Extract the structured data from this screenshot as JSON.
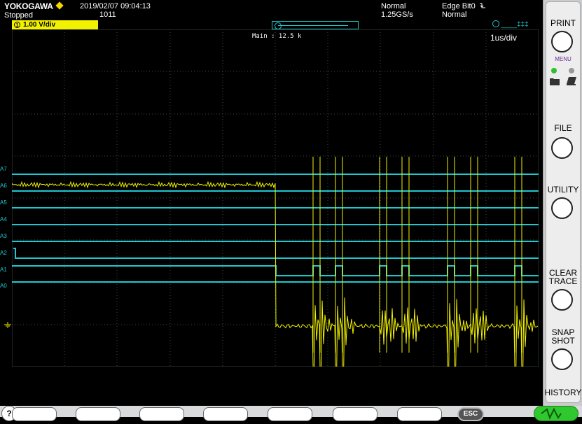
{
  "header": {
    "brand": "YOKOGAWA",
    "status": "Stopped",
    "datetime": "2019/02/07  09:04:13",
    "acq_count": "1011",
    "acq_mode": "Normal",
    "sample_rate": "1.25GS/s",
    "trigger": "Edge Bit0",
    "trigger_mode": "Normal"
  },
  "channel": {
    "num": "1",
    "scale": "1.00 V/div"
  },
  "display": {
    "zoom_label": "Main : 12.5 k",
    "timebase": "1us/div"
  },
  "logic_labels": [
    "A7",
    "A6",
    "A5",
    "A4",
    "A3",
    "A2",
    "A1",
    "A0"
  ],
  "side_panel": {
    "print": "PRINT",
    "menu": "MENU",
    "file": "FILE",
    "utility": "UTILITY",
    "clear_trace_1": "CLEAR",
    "clear_trace_2": "TRACE",
    "snap_1": "SNAP",
    "snap_2": "SHOT",
    "history": "HISTORY"
  },
  "bottom": {
    "help": "?",
    "esc": "ESC"
  },
  "colors": {
    "cyan": "#1fc7d0",
    "yellow": "#f2f200",
    "grid": "#3b4a3b"
  }
}
